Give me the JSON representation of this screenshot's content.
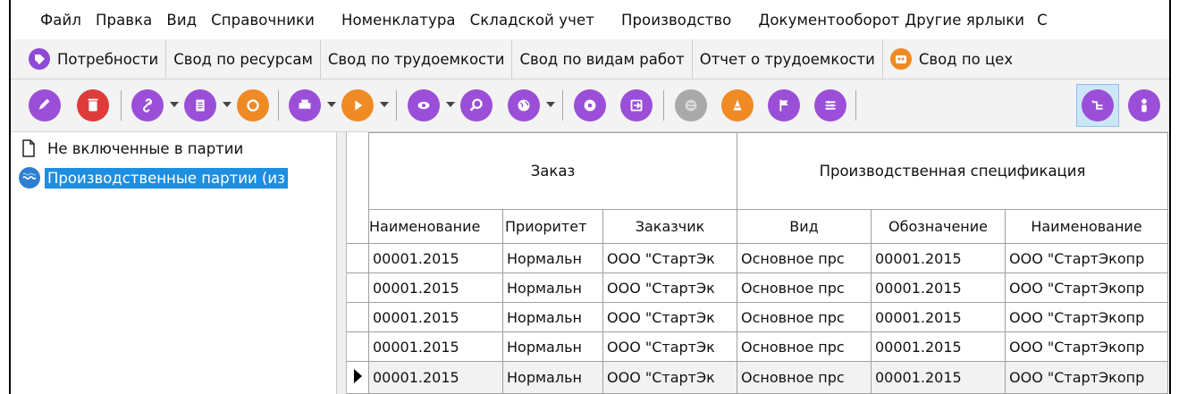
{
  "menu": {
    "items": [
      "Файл",
      "Правка",
      "Вид",
      "Справочники",
      "Номенклатура",
      "Складской учет",
      "Производство",
      "Документооборот",
      "Другие ярлыки",
      "С"
    ]
  },
  "tabs": [
    {
      "label": "Потребности",
      "icon": "needs-icon",
      "color": "#8f4ad6"
    },
    {
      "label": "Свод по ресурсам"
    },
    {
      "label": "Свод по трудоемкости"
    },
    {
      "label": "Свод по видам работ"
    },
    {
      "label": "Отчет о трудоемкости"
    },
    {
      "label": "Свод по цех",
      "icon": "workshop-icon",
      "color": "#f08a24"
    }
  ],
  "toolbar": {
    "buttons": [
      {
        "name": "edit-icon",
        "color": "#9b4fd8"
      },
      {
        "name": "delete-icon",
        "color": "#e03b3b"
      },
      {
        "name": "link-icon",
        "color": "#9b4fd8"
      },
      {
        "name": "document-icon",
        "color": "#9b4fd8"
      },
      {
        "name": "refresh-icon",
        "color": "#f08a24"
      },
      {
        "name": "print-icon",
        "color": "#9b4fd8"
      },
      {
        "name": "play-icon",
        "color": "#f08a24"
      },
      {
        "name": "view-icon",
        "color": "#9b4fd8"
      },
      {
        "name": "find-icon",
        "color": "#9b4fd8"
      },
      {
        "name": "globe-icon",
        "color": "#9b4fd8"
      },
      {
        "name": "disc-icon",
        "color": "#9b4fd8"
      },
      {
        "name": "export-icon",
        "color": "#9b4fd8"
      },
      {
        "name": "map-icon",
        "color": "#a9a9a9"
      },
      {
        "name": "cone-icon",
        "color": "#f08a24"
      },
      {
        "name": "flag-icon",
        "color": "#9b4fd8"
      },
      {
        "name": "layers-icon",
        "color": "#9b4fd8"
      },
      {
        "name": "structure-icon",
        "color": "#9b4fd8"
      },
      {
        "name": "person-icon",
        "color": "#9b4fd8"
      }
    ]
  },
  "tree": {
    "items": [
      {
        "label": "Не включенные в партии",
        "icon": "page-icon"
      },
      {
        "label": "Производственные партии (из",
        "icon": "batch-icon",
        "selected": true
      }
    ]
  },
  "grid": {
    "groups": [
      {
        "label": "Заказ"
      },
      {
        "label": "Производственная спецификация"
      }
    ],
    "columns": [
      "Наименование",
      "Приоритет",
      "Заказчик",
      "Вид",
      "Обозначение",
      "Наименование"
    ],
    "rows": [
      [
        "00001.2015",
        "Нормальн",
        "ООО \"СтартЭк",
        "Основное прс",
        "00001.2015",
        "ООО \"СтартЭкопр"
      ],
      [
        "00001.2015",
        "Нормальн",
        "ООО \"СтартЭк",
        "Основное прс",
        "00001.2015",
        "ООО \"СтартЭкопр"
      ],
      [
        "00001.2015",
        "Нормальн",
        "ООО \"СтартЭк",
        "Основное прс",
        "00001.2015",
        "ООО \"СтартЭкопр"
      ],
      [
        "00001.2015",
        "Нормальн",
        "ООО \"СтартЭк",
        "Основное прс",
        "00001.2015",
        "ООО \"СтартЭкопр"
      ],
      [
        "00001.2015",
        "Нормальн",
        "ООО \"СтартЭк",
        "Основное прс",
        "00001.2015",
        "ООО \"СтартЭкопр"
      ]
    ],
    "current_row": 4
  }
}
